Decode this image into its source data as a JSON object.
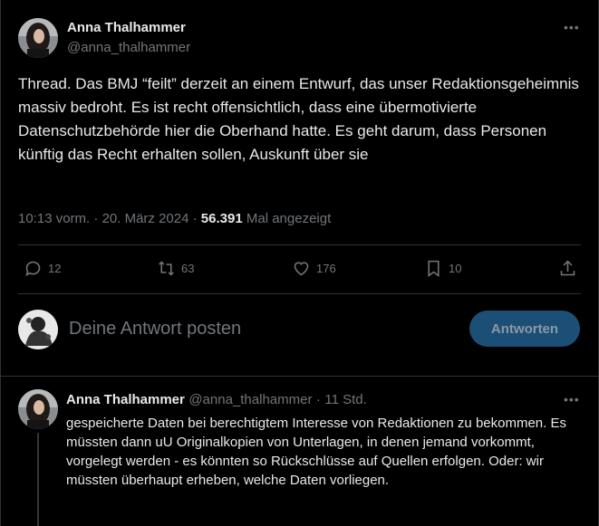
{
  "tweet": {
    "author_name": "Anna Thalhammer",
    "author_handle": "@anna_thalhammer",
    "more_icon": "more-dots-icon",
    "text": "Thread. Das BMJ “feilt” derzeit an einem Entwurf, das unser Redaktionsgeheimnis massiv bedroht. Es ist recht offensichtlich, dass eine übermotivierte Datenschutzbehörde hier die Oberhand hatte. Es geht darum, dass Personen künftig das Recht erhalten sollen, Auskunft über sie",
    "time": "10:13 vorm.",
    "sep": "·",
    "date": "20. März 2024",
    "views": "56.391",
    "views_label": "Mal angezeigt"
  },
  "actions": {
    "replies": "12",
    "retweets": "63",
    "likes": "176",
    "bookmarks": "10"
  },
  "compose": {
    "placeholder": "Deine Antwort posten",
    "button": "Antworten"
  },
  "reply": {
    "author_name": "Anna Thalhammer",
    "author_handle": "@anna_thalhammer",
    "sep": "·",
    "time": "11 Std.",
    "text": "gespeicherte Daten bei berechtigtem Interesse von Redaktionen zu bekommen. Es müssten dann uU Originalkopien von Unterlagen, in denen jemand vorkommt, vorgelegt werden - es könnten so Rückschlüsse auf Quellen erfolgen. Oder: wir müssten überhaupt erheben, welche Daten vorliegen."
  }
}
